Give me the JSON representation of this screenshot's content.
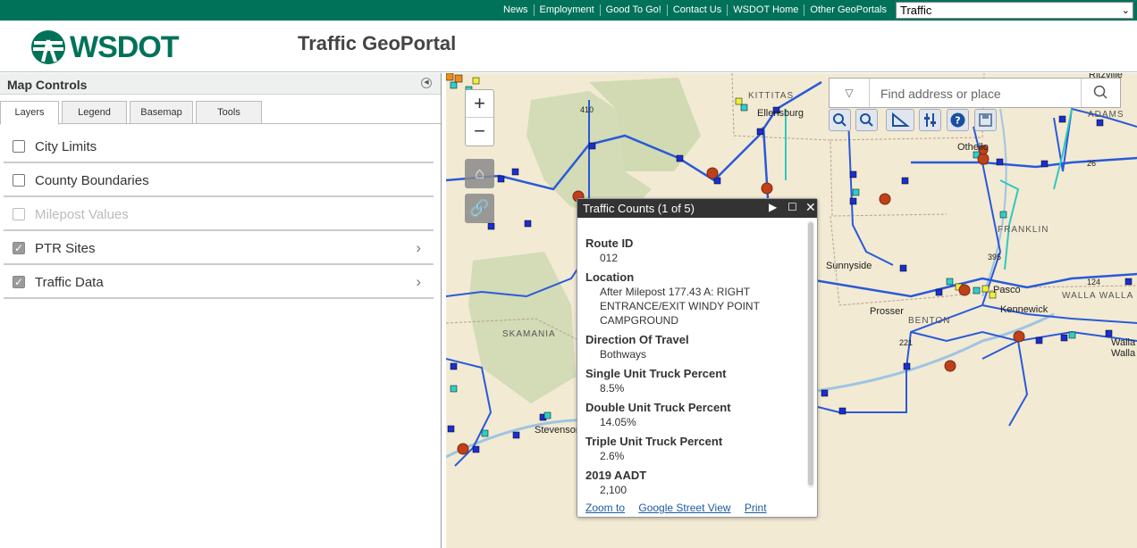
{
  "topnav": {
    "links": [
      "News",
      "Employment",
      "Good To Go!",
      "Contact Us",
      "WSDOT Home",
      "Other GeoPortals"
    ],
    "portal_select": "Traffic"
  },
  "header": {
    "logo_text": "WSDOT",
    "app_title": "Traffic GeoPortal"
  },
  "panel": {
    "title": "Map Controls",
    "tabs": [
      "Layers",
      "Legend",
      "Basemap",
      "Tools"
    ],
    "active_tab": "Layers",
    "layers": [
      {
        "label": "City Limits",
        "checked": false,
        "disabled": false,
        "expandable": false
      },
      {
        "label": "County Boundaries",
        "checked": false,
        "disabled": false,
        "expandable": false
      },
      {
        "label": "Milepost Values",
        "checked": false,
        "disabled": true,
        "expandable": false
      },
      {
        "label": "PTR Sites",
        "checked": true,
        "disabled": false,
        "expandable": true
      },
      {
        "label": "Traffic Data",
        "checked": true,
        "disabled": false,
        "expandable": true
      }
    ]
  },
  "map": {
    "search_placeholder": "Find address or place",
    "labels": {
      "kittitas": "KITTITAS",
      "ellensburg": "Ellensburg",
      "othello": "Othello",
      "adams": "ADAMS",
      "franklin": "FRANKLIN",
      "sunnyside": "Sunnyside",
      "prosser": "Prosser",
      "benton": "BENTON",
      "pasco": "Pasco",
      "kennewick": "Kennewick",
      "walla_walla_county": "WALLA WALLA",
      "skamania": "SKAMANIA",
      "stevenson": "Stevenson",
      "ritzville": "Ritzville",
      "walla_walla_city": "Walla Walla"
    },
    "shields": [
      "410",
      "26",
      "395",
      "221",
      "124"
    ],
    "accent_color": "#00725a"
  },
  "popup": {
    "title": "Traffic Counts (1 of 5)",
    "fields": [
      {
        "key": "Route ID",
        "value": "012"
      },
      {
        "key": "Location",
        "value": "After Milepost 177.43 A: RIGHT ENTRANCE/EXIT WINDY POINT CAMPGROUND"
      },
      {
        "key": "Direction Of Travel",
        "value": "Bothways"
      },
      {
        "key": "Single Unit Truck Percent",
        "value": "8.5%"
      },
      {
        "key": "Double Unit Truck Percent",
        "value": "14.05%"
      },
      {
        "key": "Triple Unit Truck Percent",
        "value": "2.6%"
      },
      {
        "key": "2019 AADT",
        "value": "2,100"
      }
    ],
    "actions": [
      "Zoom to",
      "Google Street View",
      "Print"
    ]
  }
}
